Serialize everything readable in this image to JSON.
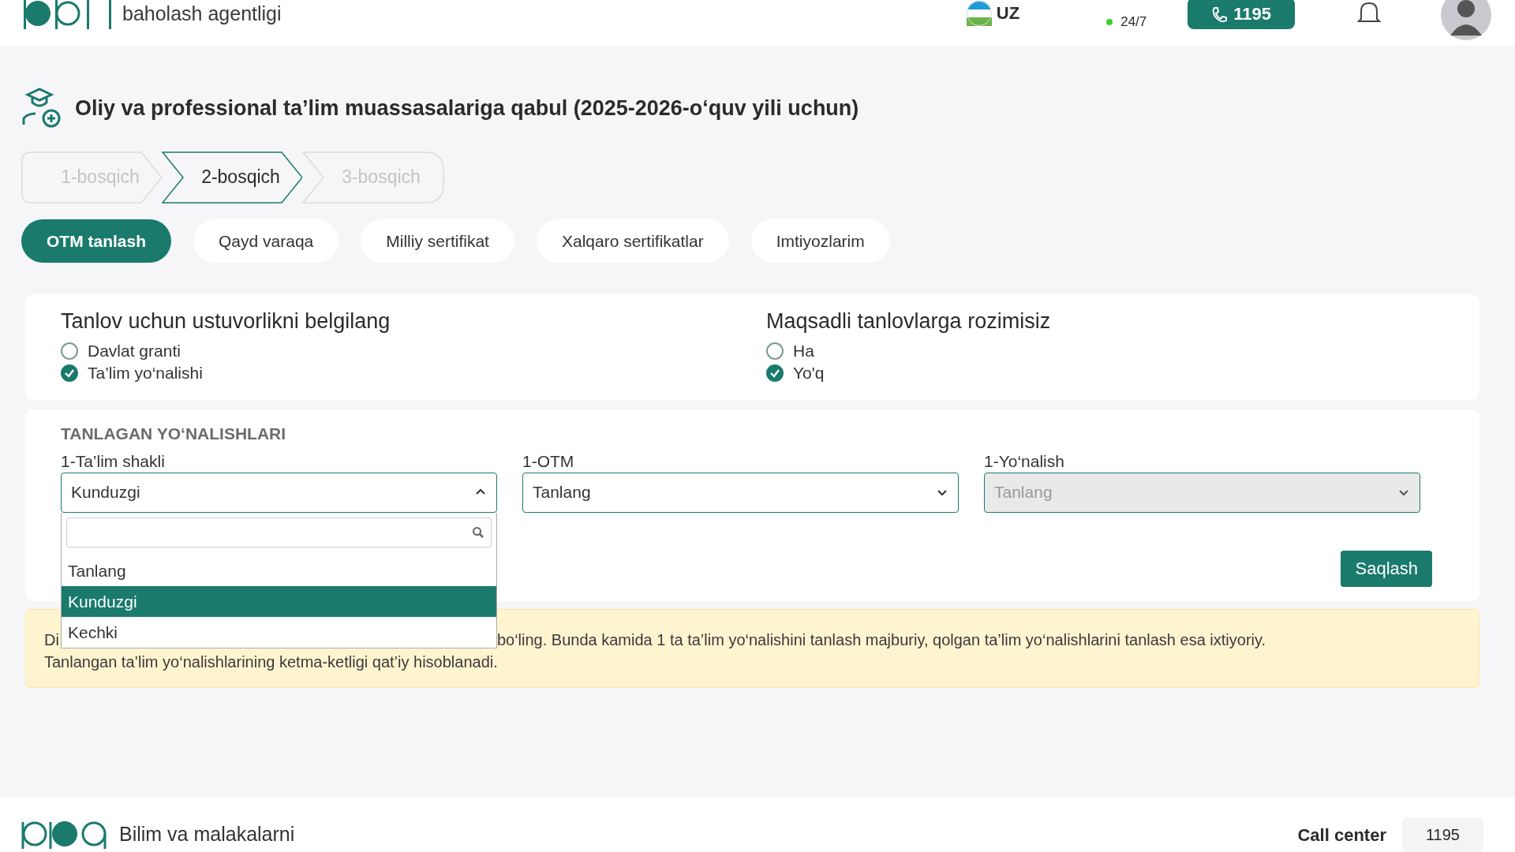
{
  "header": {
    "agency": "baholash agentligi",
    "language": "UZ",
    "support": "24/7",
    "phone": "1195"
  },
  "page_title": "Oliy va professional ta’lim muassasalariga qabul (2025-2026-o‘quv yili uchun)",
  "steps": [
    {
      "label": "1-bosqich",
      "selected": false
    },
    {
      "label": "2-bosqich",
      "selected": true
    },
    {
      "label": "3-bosqich",
      "selected": false
    }
  ],
  "tabs": [
    {
      "label": "OTM tanlash",
      "selected": true
    },
    {
      "label": "Qayd varaqa",
      "selected": false
    },
    {
      "label": "Milliy sertifikat",
      "selected": false
    },
    {
      "label": "Xalqaro sertifikatlar",
      "selected": false
    },
    {
      "label": "Imtiyozlarim",
      "selected": false
    }
  ],
  "priority": {
    "title": "Tanlov uchun ustuvorlikni belgilang",
    "options": [
      {
        "label": "Davlat granti",
        "checked": false
      },
      {
        "label": "Ta’lim yo‘nalishi",
        "checked": true
      }
    ]
  },
  "targeted": {
    "title": "Maqsadli tanlovlarga rozimisiz",
    "options": [
      {
        "label": "Ha",
        "checked": false
      },
      {
        "label": "Yo'q",
        "checked": true
      }
    ]
  },
  "directions": {
    "title": "TANLAGAN YO‘NALISHLARI",
    "fields": [
      {
        "label": "1-Ta’lim shakli",
        "value": "Kunduzgi",
        "expanded": true,
        "disabled": false
      },
      {
        "label": "1-OTM",
        "value": "Tanlang",
        "expanded": false,
        "disabled": false
      },
      {
        "label": "1-Yo‘nalish",
        "value": "Tanlang",
        "expanded": false,
        "disabled": true
      }
    ],
    "save": "Saqlash"
  },
  "dropdown": {
    "options": [
      {
        "label": "Tanlang",
        "selected": false
      },
      {
        "label": "Kunduzgi",
        "selected": true
      },
      {
        "label": "Kechki",
        "selected": false
      }
    ]
  },
  "notice": {
    "start": "Di",
    "rest": "bo‘ling. Bunda kamida 1 ta ta’lim yo‘nalishini tanlash majburiy, qolgan ta’lim yo‘nalishlarini tanlash esa ixtiyoriy.",
    "line2": "Tanlangan ta’lim yo‘nalishlarining ketma-ketligi qat’iy hisoblanadi."
  },
  "footer": {
    "tagline": "Bilim va malakalarni",
    "call_center_label": "Call center",
    "call_center_phone": "1195"
  }
}
